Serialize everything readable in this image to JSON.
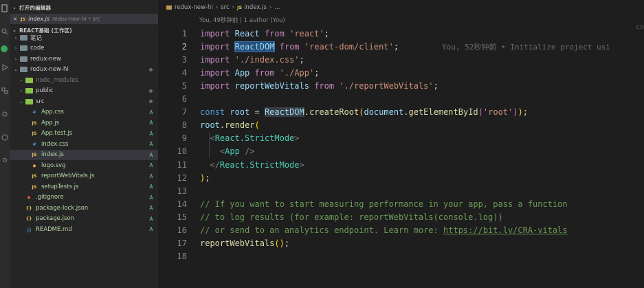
{
  "sidebar": {
    "open_editors_title": "打开的编辑器",
    "open_editor": {
      "icon": "JS",
      "name": "index.js",
      "path": "redux-new-hi • src"
    },
    "workspace_title": "REACT基础 (工作区)",
    "tree": [
      {
        "label": "笔记",
        "type": "folder",
        "color": "gray",
        "chev": "›",
        "indent": 1,
        "status": "",
        "dot": false,
        "style": ""
      },
      {
        "label": "code",
        "type": "folder",
        "color": "gray",
        "chev": "›",
        "indent": 1,
        "status": "",
        "dot": false,
        "style": ""
      },
      {
        "label": "redux-new",
        "type": "folder",
        "color": "gray",
        "chev": "›",
        "indent": 1,
        "status": "",
        "dot": false,
        "style": ""
      },
      {
        "label": "redux-new-hi",
        "type": "folder",
        "color": "gray",
        "chev": "⌄",
        "indent": 1,
        "status": "",
        "dot": true,
        "style": ""
      },
      {
        "label": "node_modules",
        "type": "folder",
        "color": "green",
        "chev": "›",
        "indent": 2,
        "status": "",
        "dot": false,
        "style": "ignored"
      },
      {
        "label": "public",
        "type": "folder",
        "color": "green",
        "chev": "›",
        "indent": 2,
        "status": "",
        "dot": true,
        "style": ""
      },
      {
        "label": "src",
        "type": "folder",
        "color": "green",
        "chev": "⌄",
        "indent": 2,
        "status": "",
        "dot": true,
        "style": ""
      },
      {
        "label": "App.css",
        "type": "css",
        "color": "",
        "chev": "",
        "indent": 3,
        "status": "A",
        "dot": false,
        "style": "added"
      },
      {
        "label": "App.js",
        "type": "js",
        "color": "",
        "chev": "",
        "indent": 3,
        "status": "A",
        "dot": false,
        "style": "added"
      },
      {
        "label": "App.test.js",
        "type": "js",
        "color": "",
        "chev": "",
        "indent": 3,
        "status": "A",
        "dot": false,
        "style": "added"
      },
      {
        "label": "index.css",
        "type": "css",
        "color": "",
        "chev": "",
        "indent": 3,
        "status": "A",
        "dot": false,
        "style": "added"
      },
      {
        "label": "index.js",
        "type": "js",
        "color": "",
        "chev": "",
        "indent": 3,
        "status": "A",
        "dot": false,
        "style": "added",
        "selected": true
      },
      {
        "label": "logo.svg",
        "type": "svg",
        "color": "",
        "chev": "",
        "indent": 3,
        "status": "A",
        "dot": false,
        "style": "added"
      },
      {
        "label": "reportWebVitals.js",
        "type": "js",
        "color": "",
        "chev": "",
        "indent": 3,
        "status": "A",
        "dot": false,
        "style": "added"
      },
      {
        "label": "setupTests.js",
        "type": "js",
        "color": "",
        "chev": "",
        "indent": 3,
        "status": "A",
        "dot": false,
        "style": "added"
      },
      {
        "label": ".gitignore",
        "type": "git",
        "color": "",
        "chev": "",
        "indent": 2,
        "status": "A",
        "dot": false,
        "style": "added"
      },
      {
        "label": "package-lock.json",
        "type": "json",
        "color": "",
        "chev": "",
        "indent": 2,
        "status": "A",
        "dot": false,
        "style": "added"
      },
      {
        "label": "package.json",
        "type": "json",
        "color": "",
        "chev": "",
        "indent": 2,
        "status": "A",
        "dot": false,
        "style": "added"
      },
      {
        "label": "README.md",
        "type": "md",
        "color": "",
        "chev": "",
        "indent": 2,
        "status": "A",
        "dot": false,
        "style": "added"
      }
    ]
  },
  "editor": {
    "breadcrumb": [
      "redux-new-hi",
      "src",
      "index.js",
      "..."
    ],
    "blame_header": "You, 49秒钟前 | 1 author (You)",
    "inline_blame": "You, 52秒钟前 • Initialize project usi",
    "active_line": 2,
    "lines": [
      {
        "n": "1",
        "html": "<span class='kwc'>import</span> <span class='id'>React</span> <span class='kwc'>from</span> <span class='str'>'react'</span>;"
      },
      {
        "n": "2",
        "html": "<span class='kwc'>import</span> <span class='id sel'>ReactDOM</span> <span class='kwc'>from</span> <span class='str'>'react-dom/client'</span>;"
      },
      {
        "n": "3",
        "html": "<span class='kwc'>import</span> <span class='str'>'./index.css'</span>;"
      },
      {
        "n": "4",
        "html": "<span class='kwc'>import</span> <span class='id'>App</span> <span class='kwc'>from</span> <span class='str'>'./App'</span>;"
      },
      {
        "n": "5",
        "html": "<span class='kwc'>import</span> <span class='id'>reportWebVitals</span> <span class='kwc'>from</span> <span class='str'>'./reportWebVitals'</span>;"
      },
      {
        "n": "6",
        "html": ""
      },
      {
        "n": "7",
        "html": "<span class='kw'>const</span> <span class='id'>root</span> = <span class='id hl'>ReactDOM</span>.<span class='fn'>createRoot</span><span class='paren1'>(</span><span class='id'>document</span>.<span class='fn'>getElementById</span><span class='paren2'>(</span><span class='str'>'root'</span><span class='paren2'>)</span><span class='paren1'>)</span>;"
      },
      {
        "n": "8",
        "html": "<span class='id'>root</span>.<span class='fn'>render</span><span class='paren1'>(</span>"
      },
      {
        "n": "9",
        "html": "  <span class='br'>&lt;</span><span class='tag'>React.StrictMode</span><span class='br'>&gt;</span>"
      },
      {
        "n": "10",
        "html": "    <span class='br'>&lt;</span><span class='tag'>App</span> <span class='br'>/&gt;</span>"
      },
      {
        "n": "11",
        "html": "  <span class='br'>&lt;/</span><span class='tag'>React.StrictMode</span><span class='br'>&gt;</span>"
      },
      {
        "n": "12",
        "html": "<span class='paren1'>)</span>;"
      },
      {
        "n": "13",
        "html": ""
      },
      {
        "n": "14",
        "html": "<span class='cm'>// If you want to start measuring performance in your app, pass a function</span>"
      },
      {
        "n": "15",
        "html": "<span class='cm'>// to log results (for example: reportWebVitals(console.log))</span>"
      },
      {
        "n": "16",
        "html": "<span class='cm'>// or send to an analytics endpoint. Learn more: </span><span class='link'>https://bit.ly/CRA-vitals</span>"
      },
      {
        "n": "17",
        "html": "<span class='fn'>reportWebVitals</span><span class='paren1'>()</span>;"
      },
      {
        "n": "18",
        "html": ""
      }
    ]
  },
  "right_edge_text": "co"
}
